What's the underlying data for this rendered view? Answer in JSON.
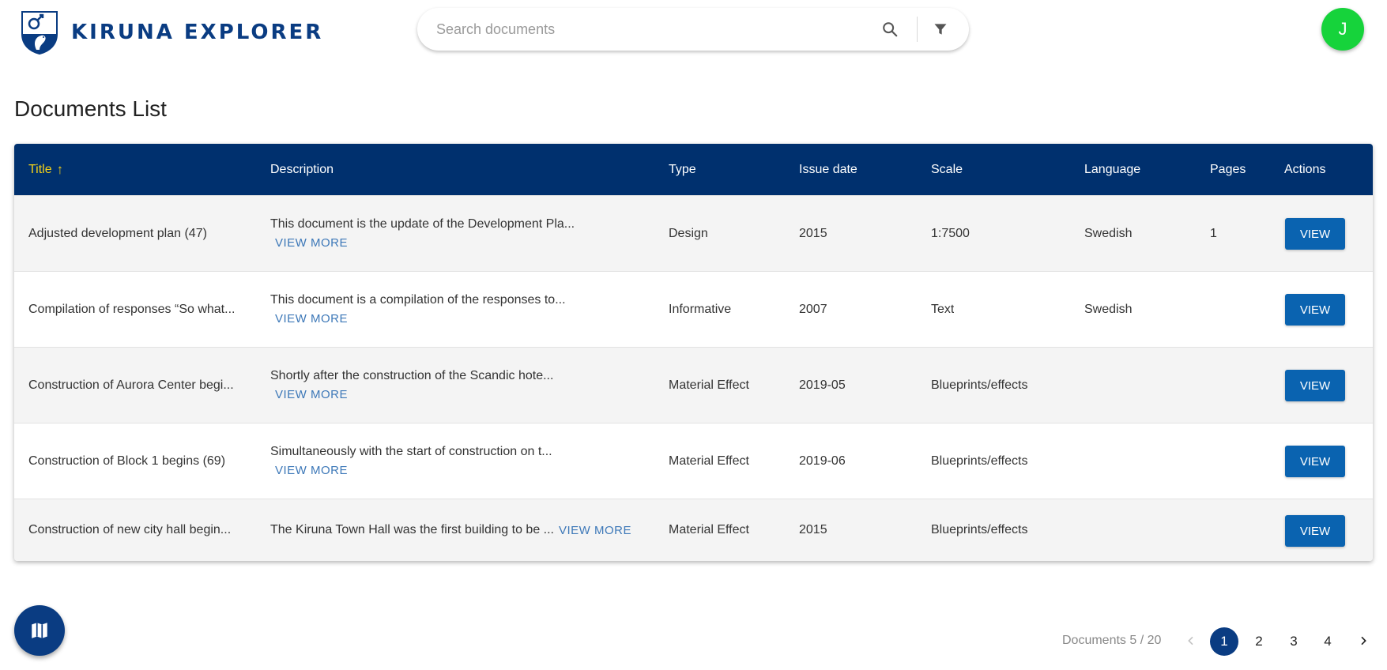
{
  "app": {
    "name": "KIRUNA EXPLORER",
    "brand_color": "#0a3c82"
  },
  "search": {
    "placeholder": "Search documents",
    "search_icon": "search-icon",
    "filter_icon": "filter-icon"
  },
  "user": {
    "initial": "J",
    "avatar_color": "#16d33b"
  },
  "page": {
    "title": "Documents List"
  },
  "table": {
    "header_color": "#00306e",
    "sort_color": "#f5d117",
    "columns": {
      "title": "Title",
      "description": "Description",
      "type": "Type",
      "issue_date": "Issue date",
      "scale": "Scale",
      "language": "Language",
      "pages": "Pages",
      "actions": "Actions"
    },
    "sort_indicator": "↑",
    "view_more_label": "VIEW MORE",
    "view_button_label": "VIEW",
    "rows": [
      {
        "title": "Adjusted development plan (47)",
        "description": "This document is the update of the Development Pla...",
        "type": "Design",
        "issue_date": "2015",
        "scale": "1:7500",
        "language": "Swedish",
        "pages": "1"
      },
      {
        "title": "Compilation of responses “So what...",
        "description": "This document is a compilation of the responses to...",
        "type": "Informative",
        "issue_date": "2007",
        "scale": "Text",
        "language": "Swedish",
        "pages": ""
      },
      {
        "title": "Construction of Aurora Center begi...",
        "description": "Shortly after the construction of the Scandic hote...",
        "type": "Material Effect",
        "issue_date": "2019-05",
        "scale": "Blueprints/effects",
        "language": "",
        "pages": ""
      },
      {
        "title": "Construction of Block 1 begins (69)",
        "description": "Simultaneously with the start of construction on t...",
        "type": "Material Effect",
        "issue_date": "2019-06",
        "scale": "Blueprints/effects",
        "language": "",
        "pages": ""
      },
      {
        "title": "Construction of new city hall begin...",
        "description": "The Kiruna Town Hall was the first building to be ...",
        "type": "Material Effect",
        "issue_date": "2015",
        "scale": "Blueprints/effects",
        "language": "",
        "pages": ""
      }
    ]
  },
  "map_button": {
    "icon": "map-icon"
  },
  "pagination": {
    "summary": "Documents 5 / 20",
    "pages": [
      "1",
      "2",
      "3",
      "4"
    ],
    "current_page": "1",
    "prev_icon": "chevron-left-icon",
    "next_icon": "chevron-right-icon"
  }
}
